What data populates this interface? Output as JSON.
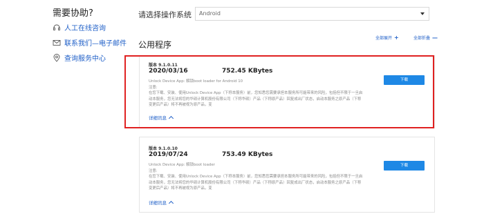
{
  "help": {
    "title": "需要协助?",
    "links": [
      {
        "label": "人工在线咨询",
        "icon": "headset-icon"
      },
      {
        "label": "联系我们—电子邮件",
        "icon": "mail-icon"
      },
      {
        "label": "查询服务中心",
        "icon": "location-pin-icon"
      }
    ]
  },
  "os": {
    "label": "请选择操作系统",
    "selected": "Android"
  },
  "controls": {
    "expand_all": "全部展开",
    "expand_symbol": "+",
    "collapse_all": "全部折叠",
    "collapse_symbol": "—"
  },
  "section": {
    "title": "公用程序"
  },
  "items": [
    {
      "version": "版本 9.1.0.11",
      "date": "2020/03/16",
      "size": "752.45 KBytes",
      "description_title": "Unlock Device App: 解锁boot loader for Android 10",
      "notice_label": "注意:",
      "notice_text": "在您下载、安装、使用Unlock Device App（下称本服务）前，您知悉您需要承担本服务所可能带来的风险，包括但不限于一旦启动本服务，您无法将您的华硕计算机股份有限公司（下称华硕）产品（下称原产品）回复成出厂状态，启动本服务之原产品（下称变更后产品）将不再被视为原产品，变",
      "more": "详细讯息",
      "download": "下载"
    },
    {
      "version": "版本 9.1.0.10",
      "date": "2019/07/24",
      "size": "753.49 KBytes",
      "description_title": "Unlock Device App: 解锁boot loader",
      "notice_label": "注意:",
      "notice_text": "在您下载、安装、使用Unlock Device App（下称本服务）前，您知悉您需要承担本服务所可能带来的风险，包括但不限于一旦启动本服务，您无法将您的华硕计算机股份有限公司（下称华硕）产品（下称原产品）回复成出厂状态，启动本服务之原产品（下称变更后产品）将不再被视为原产品，变",
      "more": "详细讯息",
      "download": "下载"
    }
  ],
  "colors": {
    "link": "#2060c8",
    "button": "#1e88e5",
    "highlight": "#e02020"
  }
}
